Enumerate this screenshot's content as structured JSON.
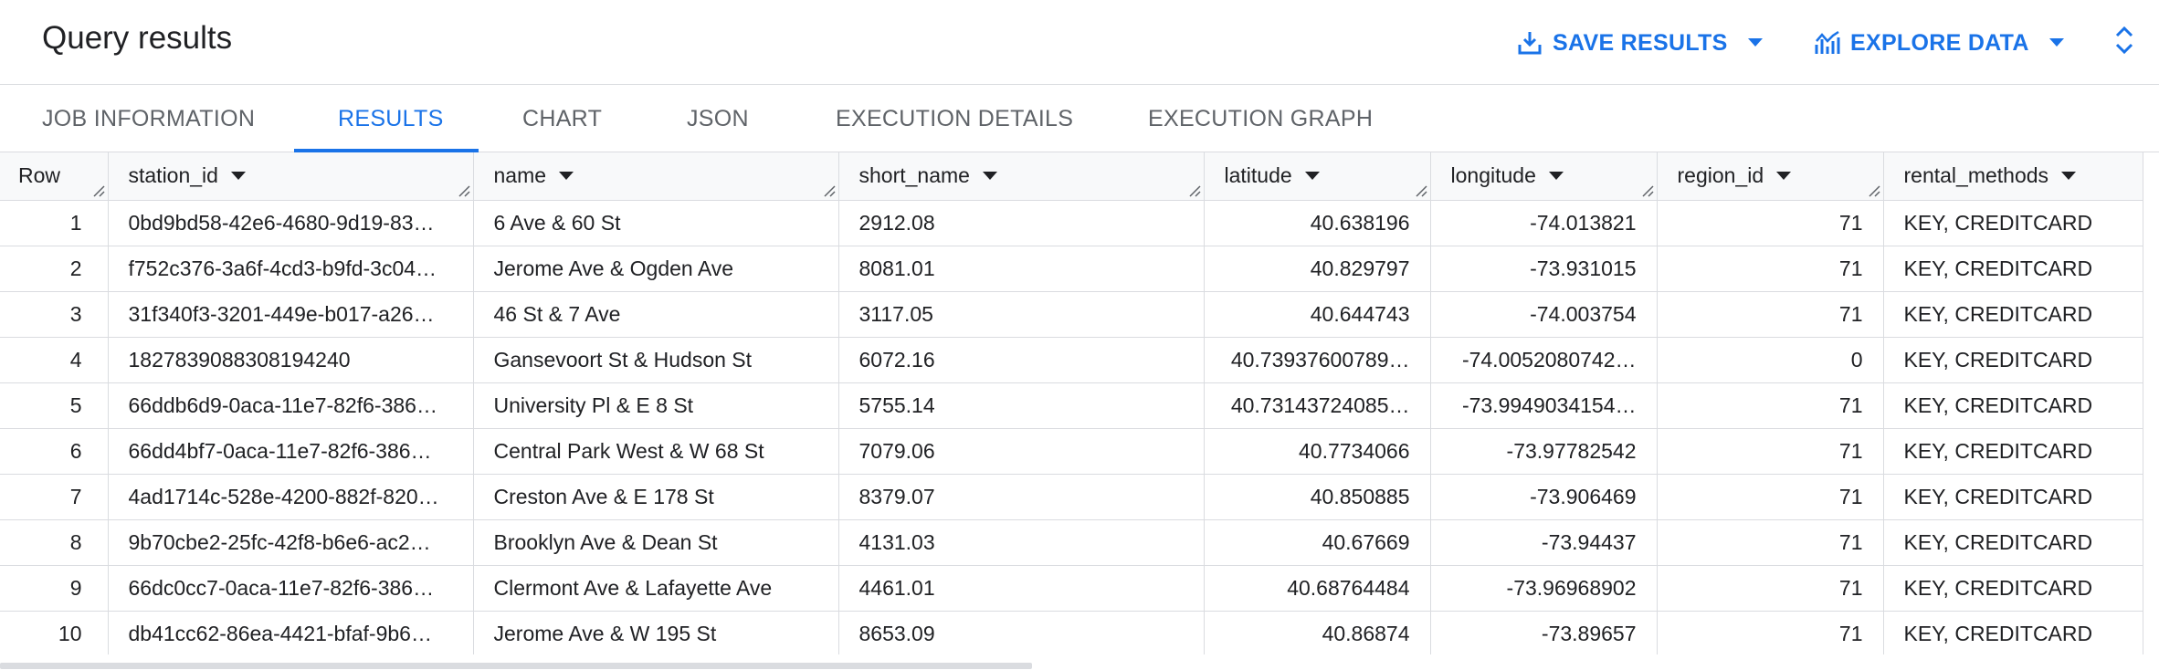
{
  "header": {
    "title": "Query results",
    "save_results_label": "SAVE RESULTS",
    "explore_data_label": "EXPLORE DATA",
    "save_icon": "download-icon",
    "explore_icon": "chart-icon",
    "collapse_icon": "unfold-icon"
  },
  "tabs": [
    {
      "label": "JOB INFORMATION",
      "active": false
    },
    {
      "label": "RESULTS",
      "active": true
    },
    {
      "label": "CHART",
      "active": false
    },
    {
      "label": "JSON",
      "active": false
    },
    {
      "label": "EXECUTION DETAILS",
      "active": false
    },
    {
      "label": "EXECUTION GRAPH",
      "active": false
    }
  ],
  "table": {
    "columns": [
      "Row",
      "station_id",
      "name",
      "short_name",
      "latitude",
      "longitude",
      "region_id",
      "rental_methods"
    ],
    "rows": [
      [
        "1",
        "0bd9bd58-42e6-4680-9d19-83…",
        "6 Ave & 60 St",
        "2912.08",
        "40.638196",
        "-74.013821",
        "71",
        "KEY, CREDITCARD"
      ],
      [
        "2",
        "f752c376-3a6f-4cd3-b9fd-3c04…",
        "Jerome Ave & Ogden Ave",
        "8081.01",
        "40.829797",
        "-73.931015",
        "71",
        "KEY, CREDITCARD"
      ],
      [
        "3",
        "31f340f3-3201-449e-b017-a26…",
        "46 St & 7 Ave",
        "3117.05",
        "40.644743",
        "-74.003754",
        "71",
        "KEY, CREDITCARD"
      ],
      [
        "4",
        "1827839088308194240",
        "Gansevoort St & Hudson St",
        "6072.16",
        "40.73937600789…",
        "-74.0052080742…",
        "0",
        "KEY, CREDITCARD"
      ],
      [
        "5",
        "66ddb6d9-0aca-11e7-82f6-386…",
        "University Pl & E 8 St",
        "5755.14",
        "40.73143724085…",
        "-73.9949034154…",
        "71",
        "KEY, CREDITCARD"
      ],
      [
        "6",
        "66dd4bf7-0aca-11e7-82f6-386…",
        "Central Park West & W 68 St",
        "7079.06",
        "40.7734066",
        "-73.97782542",
        "71",
        "KEY, CREDITCARD"
      ],
      [
        "7",
        "4ad1714c-528e-4200-882f-820…",
        "Creston Ave & E 178 St",
        "8379.07",
        "40.850885",
        "-73.906469",
        "71",
        "KEY, CREDITCARD"
      ],
      [
        "8",
        "9b70cbe2-25fc-42f8-b6e6-ac2…",
        "Brooklyn Ave & Dean St",
        "4131.03",
        "40.67669",
        "-73.94437",
        "71",
        "KEY, CREDITCARD"
      ],
      [
        "9",
        "66dc0cc7-0aca-11e7-82f6-386…",
        "Clermont Ave & Lafayette Ave",
        "4461.01",
        "40.68764484",
        "-73.96968902",
        "71",
        "KEY, CREDITCARD"
      ],
      [
        "10",
        "db41cc62-86ea-4421-bfaf-9b6…",
        "Jerome Ave & W 195 St",
        "8653.09",
        "40.86874",
        "-73.89657",
        "71",
        "KEY, CREDITCARD"
      ]
    ]
  },
  "colors": {
    "accent": "#1a73e8",
    "text": "#202124",
    "muted": "#5f6368",
    "border": "#dadce0",
    "header_bg": "#f8f9fa"
  }
}
